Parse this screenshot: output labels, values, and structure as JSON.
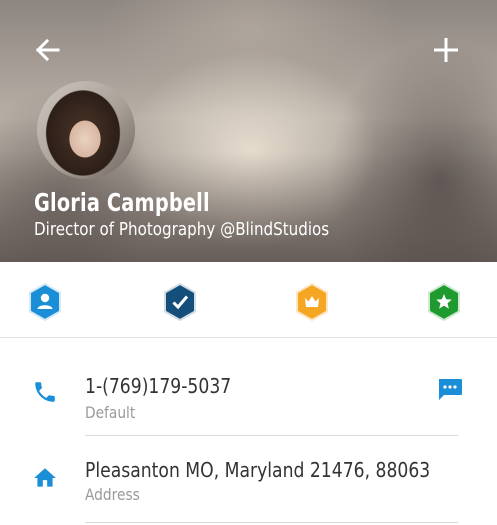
{
  "colors": {
    "accent": "#1a8fd8",
    "header_text": "#ffffff",
    "primary_text": "#333333",
    "secondary_text": "#9a9a9a",
    "badge_person": "#1a8fd8",
    "badge_verified": "#144e7a",
    "badge_crown": "#f5a623",
    "badge_star": "#1f9a2e"
  },
  "header": {
    "back_icon": "arrow-back-icon",
    "add_icon": "plus-icon"
  },
  "profile": {
    "name": "Gloria Campbell",
    "title": "Director of Photography @BlindStudios"
  },
  "badges": [
    {
      "icon": "person-badge-icon"
    },
    {
      "icon": "verified-badge-icon"
    },
    {
      "icon": "crown-badge-icon"
    },
    {
      "icon": "star-badge-icon"
    }
  ],
  "contacts": [
    {
      "icon": "phone-icon",
      "value": "1-(769)179-5037",
      "label": "Default",
      "action_icon": "message-icon"
    },
    {
      "icon": "home-icon",
      "value": "Pleasanton MO, Maryland 21476, 88063",
      "label": "Address"
    }
  ]
}
